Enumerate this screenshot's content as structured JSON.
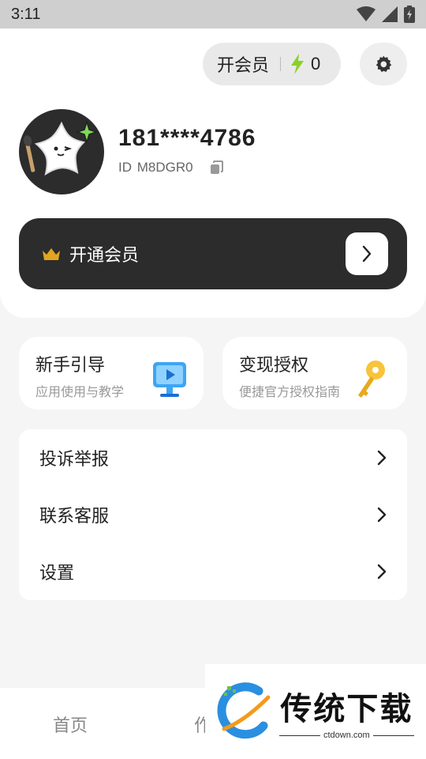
{
  "status_bar": {
    "time": "3:11"
  },
  "header": {
    "vip_pill_label": "开会员",
    "energy_count": "0"
  },
  "profile": {
    "username": "181****4786",
    "id_label": "ID",
    "id_value": "M8DGR0"
  },
  "vip_banner": {
    "label": "开通会员"
  },
  "features": [
    {
      "title": "新手引导",
      "subtitle": "应用使用与教学",
      "icon": "monitor-play-icon"
    },
    {
      "title": "变现授权",
      "subtitle": "便捷官方授权指南",
      "icon": "key-icon"
    }
  ],
  "menu": [
    {
      "label": "投诉举报"
    },
    {
      "label": "联系客服"
    },
    {
      "label": "设置"
    }
  ],
  "bottom_nav": [
    {
      "label": "首页"
    },
    {
      "label": "作"
    }
  ],
  "watermark": {
    "title": "传统下载",
    "url": "ctdown.com"
  },
  "colors": {
    "dark_banner": "#2c2c2c",
    "energy": "#8ad12a",
    "crown": "#e0a521"
  }
}
